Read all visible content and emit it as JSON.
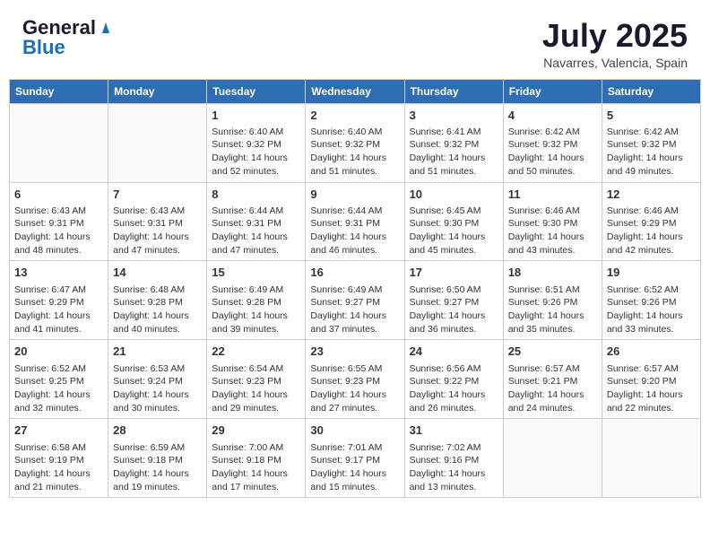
{
  "logo": {
    "general": "General",
    "blue": "Blue"
  },
  "title": {
    "month_year": "July 2025",
    "location": "Navarres, Valencia, Spain"
  },
  "weekdays": [
    "Sunday",
    "Monday",
    "Tuesday",
    "Wednesday",
    "Thursday",
    "Friday",
    "Saturday"
  ],
  "weeks": [
    [
      {
        "day": "",
        "empty": true
      },
      {
        "day": "",
        "empty": true
      },
      {
        "day": "1",
        "sunrise": "Sunrise: 6:40 AM",
        "sunset": "Sunset: 9:32 PM",
        "daylight": "Daylight: 14 hours and 52 minutes."
      },
      {
        "day": "2",
        "sunrise": "Sunrise: 6:40 AM",
        "sunset": "Sunset: 9:32 PM",
        "daylight": "Daylight: 14 hours and 51 minutes."
      },
      {
        "day": "3",
        "sunrise": "Sunrise: 6:41 AM",
        "sunset": "Sunset: 9:32 PM",
        "daylight": "Daylight: 14 hours and 51 minutes."
      },
      {
        "day": "4",
        "sunrise": "Sunrise: 6:42 AM",
        "sunset": "Sunset: 9:32 PM",
        "daylight": "Daylight: 14 hours and 50 minutes."
      },
      {
        "day": "5",
        "sunrise": "Sunrise: 6:42 AM",
        "sunset": "Sunset: 9:32 PM",
        "daylight": "Daylight: 14 hours and 49 minutes."
      }
    ],
    [
      {
        "day": "6",
        "sunrise": "Sunrise: 6:43 AM",
        "sunset": "Sunset: 9:31 PM",
        "daylight": "Daylight: 14 hours and 48 minutes."
      },
      {
        "day": "7",
        "sunrise": "Sunrise: 6:43 AM",
        "sunset": "Sunset: 9:31 PM",
        "daylight": "Daylight: 14 hours and 47 minutes."
      },
      {
        "day": "8",
        "sunrise": "Sunrise: 6:44 AM",
        "sunset": "Sunset: 9:31 PM",
        "daylight": "Daylight: 14 hours and 47 minutes."
      },
      {
        "day": "9",
        "sunrise": "Sunrise: 6:44 AM",
        "sunset": "Sunset: 9:31 PM",
        "daylight": "Daylight: 14 hours and 46 minutes."
      },
      {
        "day": "10",
        "sunrise": "Sunrise: 6:45 AM",
        "sunset": "Sunset: 9:30 PM",
        "daylight": "Daylight: 14 hours and 45 minutes."
      },
      {
        "day": "11",
        "sunrise": "Sunrise: 6:46 AM",
        "sunset": "Sunset: 9:30 PM",
        "daylight": "Daylight: 14 hours and 43 minutes."
      },
      {
        "day": "12",
        "sunrise": "Sunrise: 6:46 AM",
        "sunset": "Sunset: 9:29 PM",
        "daylight": "Daylight: 14 hours and 42 minutes."
      }
    ],
    [
      {
        "day": "13",
        "sunrise": "Sunrise: 6:47 AM",
        "sunset": "Sunset: 9:29 PM",
        "daylight": "Daylight: 14 hours and 41 minutes."
      },
      {
        "day": "14",
        "sunrise": "Sunrise: 6:48 AM",
        "sunset": "Sunset: 9:28 PM",
        "daylight": "Daylight: 14 hours and 40 minutes."
      },
      {
        "day": "15",
        "sunrise": "Sunrise: 6:49 AM",
        "sunset": "Sunset: 9:28 PM",
        "daylight": "Daylight: 14 hours and 39 minutes."
      },
      {
        "day": "16",
        "sunrise": "Sunrise: 6:49 AM",
        "sunset": "Sunset: 9:27 PM",
        "daylight": "Daylight: 14 hours and 37 minutes."
      },
      {
        "day": "17",
        "sunrise": "Sunrise: 6:50 AM",
        "sunset": "Sunset: 9:27 PM",
        "daylight": "Daylight: 14 hours and 36 minutes."
      },
      {
        "day": "18",
        "sunrise": "Sunrise: 6:51 AM",
        "sunset": "Sunset: 9:26 PM",
        "daylight": "Daylight: 14 hours and 35 minutes."
      },
      {
        "day": "19",
        "sunrise": "Sunrise: 6:52 AM",
        "sunset": "Sunset: 9:26 PM",
        "daylight": "Daylight: 14 hours and 33 minutes."
      }
    ],
    [
      {
        "day": "20",
        "sunrise": "Sunrise: 6:52 AM",
        "sunset": "Sunset: 9:25 PM",
        "daylight": "Daylight: 14 hours and 32 minutes."
      },
      {
        "day": "21",
        "sunrise": "Sunrise: 6:53 AM",
        "sunset": "Sunset: 9:24 PM",
        "daylight": "Daylight: 14 hours and 30 minutes."
      },
      {
        "day": "22",
        "sunrise": "Sunrise: 6:54 AM",
        "sunset": "Sunset: 9:23 PM",
        "daylight": "Daylight: 14 hours and 29 minutes."
      },
      {
        "day": "23",
        "sunrise": "Sunrise: 6:55 AM",
        "sunset": "Sunset: 9:23 PM",
        "daylight": "Daylight: 14 hours and 27 minutes."
      },
      {
        "day": "24",
        "sunrise": "Sunrise: 6:56 AM",
        "sunset": "Sunset: 9:22 PM",
        "daylight": "Daylight: 14 hours and 26 minutes."
      },
      {
        "day": "25",
        "sunrise": "Sunrise: 6:57 AM",
        "sunset": "Sunset: 9:21 PM",
        "daylight": "Daylight: 14 hours and 24 minutes."
      },
      {
        "day": "26",
        "sunrise": "Sunrise: 6:57 AM",
        "sunset": "Sunset: 9:20 PM",
        "daylight": "Daylight: 14 hours and 22 minutes."
      }
    ],
    [
      {
        "day": "27",
        "sunrise": "Sunrise: 6:58 AM",
        "sunset": "Sunset: 9:19 PM",
        "daylight": "Daylight: 14 hours and 21 minutes."
      },
      {
        "day": "28",
        "sunrise": "Sunrise: 6:59 AM",
        "sunset": "Sunset: 9:18 PM",
        "daylight": "Daylight: 14 hours and 19 minutes."
      },
      {
        "day": "29",
        "sunrise": "Sunrise: 7:00 AM",
        "sunset": "Sunset: 9:18 PM",
        "daylight": "Daylight: 14 hours and 17 minutes."
      },
      {
        "day": "30",
        "sunrise": "Sunrise: 7:01 AM",
        "sunset": "Sunset: 9:17 PM",
        "daylight": "Daylight: 14 hours and 15 minutes."
      },
      {
        "day": "31",
        "sunrise": "Sunrise: 7:02 AM",
        "sunset": "Sunset: 9:16 PM",
        "daylight": "Daylight: 14 hours and 13 minutes."
      },
      {
        "day": "",
        "empty": true
      },
      {
        "day": "",
        "empty": true
      }
    ]
  ]
}
